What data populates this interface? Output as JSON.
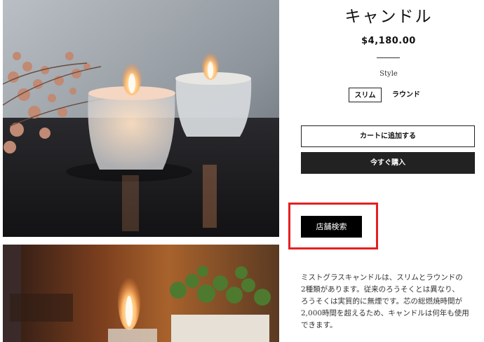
{
  "product": {
    "title": "キャンドル",
    "price": "$4,180.00",
    "option_label": "Style",
    "options": [
      "スリム",
      "ラウンド"
    ],
    "selected_option": "スリム"
  },
  "actions": {
    "add_to_cart": "カートに追加する",
    "buy_now": "今すぐ購入",
    "store_search": "店舗検索"
  },
  "description": "ミストグラスキャンドルは、スリムとラウンドの\n2種類があります。従来のろうそくとは異なり、\nろうそくは実質的に無煙です。芯の総燃焼時間が\n2,000時間を超えるため、キャンドルは何年も使用\nできます。",
  "annotation": {
    "color": "#e52020"
  }
}
